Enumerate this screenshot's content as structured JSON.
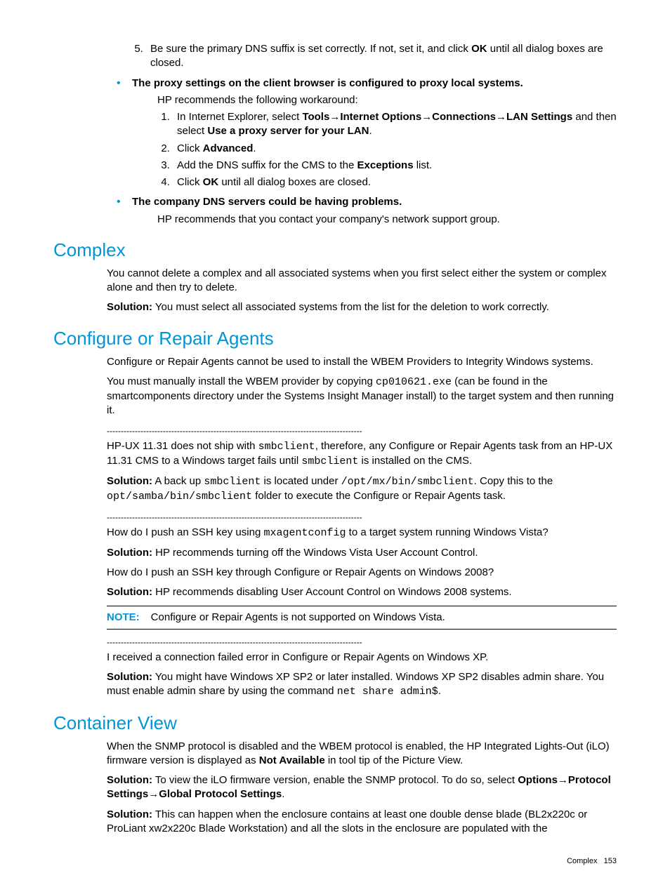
{
  "intro": {
    "step5": {
      "num": "5.",
      "text_a": "Be sure the primary DNS suffix is set correctly. If not, set it, and click ",
      "ok": "OK",
      "text_b": " until all dialog boxes are closed."
    },
    "proxy": {
      "title": "The proxy settings on the client browser is configured to proxy local systems.",
      "rec": "HP recommends the following workaround:",
      "s1_a": "In Internet Explorer, select ",
      "s1_tools": "Tools",
      "s1_arrow1": "→",
      "s1_io": "Internet Options",
      "s1_arrow2": "→",
      "s1_conn": "Connections",
      "s1_arrow3": "→",
      "s1_lan": "LAN Settings",
      "s1_b": " and then select ",
      "s1_use": "Use a proxy server for your LAN",
      "s1_c": ".",
      "s2_a": "Click ",
      "s2_adv": "Advanced",
      "s2_b": ".",
      "s3_a": "Add the DNS suffix for the CMS to the ",
      "s3_exc": "Exceptions",
      "s3_b": " list.",
      "s4_a": "Click ",
      "s4_ok": "OK",
      "s4_b": " until all dialog boxes are closed."
    },
    "dns": {
      "title": "The company DNS servers could be having problems.",
      "text": "HP recommends that you contact your company's network support group."
    }
  },
  "complex": {
    "heading": "Complex",
    "p1": "You cannot delete a complex and all associated systems when you first select either the system or complex alone and then try to delete.",
    "sol_label": "Solution:",
    "sol_text": " You must select all associated systems from the list for the deletion to work correctly."
  },
  "cra": {
    "heading": "Configure or Repair Agents",
    "p1": "Configure or Repair Agents cannot be used to install the WBEM Providers to Integrity Windows systems.",
    "p2_a": "You must manually install the WBEM provider by copying ",
    "p2_code": "cp010621.exe",
    "p2_b": " (can be found in the smartcomponents directory under the Systems Insight Manager install) to the target system and then running it.",
    "sep": "-------------------------------------------------------------------------------------------",
    "p3_a": "HP-UX 11.31 does not ship with ",
    "p3_code1": "smbclient",
    "p3_b": ", therefore, any Configure or Repair Agents task from an HP-UX 11.31 CMS to a Windows target fails until ",
    "p3_code2": "smbclient",
    "p3_c": " is installed on the CMS.",
    "sol1_label": "Solution:",
    "sol1_a": " A back up ",
    "sol1_code1": "smbclient",
    "sol1_b": " is located under ",
    "sol1_code2": "/opt/mx/bin/smbclient",
    "sol1_c": ". Copy this to the ",
    "sol1_code3": "opt/samba/bin/smbclient",
    "sol1_d": " folder to execute the Configure or Repair Agents task.",
    "p4_a": "How do I push an SSH key using ",
    "p4_code": "mxagentconfig",
    "p4_b": " to a target system running Windows Vista?",
    "sol2_label": "Solution:",
    "sol2_text": " HP recommends turning off the Windows Vista User Account Control.",
    "p5": "How do I push an SSH key through Configure or Repair Agents on Windows 2008?",
    "sol3_label": "Solution:",
    "sol3_text": " HP recommends disabling User Account Control on Windows 2008 systems.",
    "note_label": "NOTE:",
    "note_text": "Configure or Repair Agents is not supported on Windows Vista.",
    "p6": "I received a connection failed error in Configure or Repair Agents on Windows XP.",
    "sol4_label": "Solution:",
    "sol4_a": " You might have Windows XP SP2 or later installed. Windows XP SP2 disables admin share. You must enable admin share by using the command ",
    "sol4_code": "net share admin$",
    "sol4_b": "."
  },
  "cv": {
    "heading": "Container View",
    "p1_a": "When the SNMP protocol is disabled and the WBEM protocol is enabled, the HP Integrated Lights-Out (iLO) firmware version is displayed as ",
    "p1_na": "Not Available",
    "p1_b": " in tool tip of the Picture View.",
    "sol1_label": "Solution:",
    "sol1_a": " To view the iLO firmware version, enable the SNMP protocol. To do so, select ",
    "sol1_opt": "Options",
    "sol1_arrow1": "→",
    "sol1_ps": "Protocol Settings",
    "sol1_arrow2": "→",
    "sol1_gps": "Global Protocol Settings",
    "sol1_b": ".",
    "sol2_label": "Solution:",
    "sol2_text": " This can happen when the enclosure contains at least one double dense blade (BL2x220c or ProLiant xw2x220c Blade Workstation) and all the slots in the enclosure are populated with the"
  },
  "footer": {
    "section": "Complex",
    "page": "153"
  }
}
